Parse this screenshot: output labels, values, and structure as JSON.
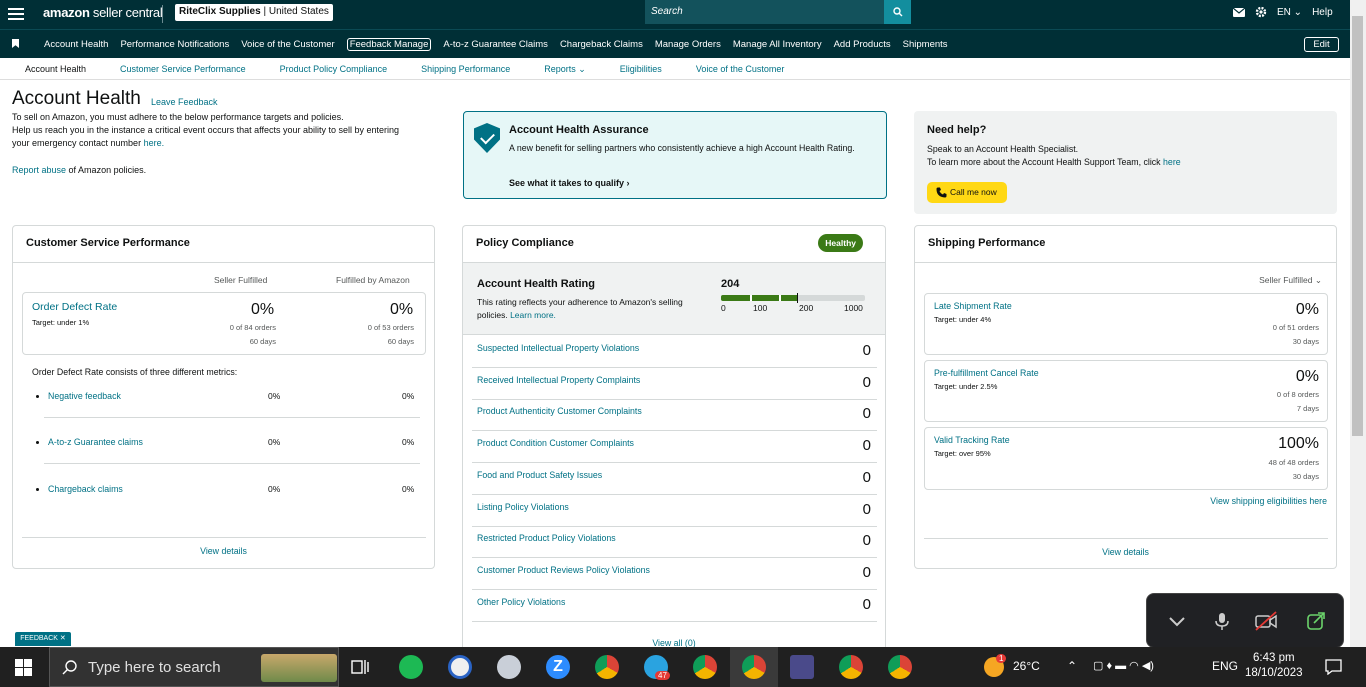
{
  "topbar": {
    "logo_main": "amazon",
    "logo_rest": " seller central",
    "store_name": "RiteClix Supplies",
    "store_region": " | United States",
    "search_placeholder": "Search",
    "lang": "EN",
    "help": "Help"
  },
  "nav": {
    "items": [
      "Account Health",
      "Performance Notifications",
      "Voice of the Customer",
      "Feedback Manage",
      "A-to-z Guarantee Claims",
      "Chargeback Claims",
      "Manage Orders",
      "Manage All Inventory",
      "Add Products",
      "Shipments"
    ],
    "edit": "Edit"
  },
  "subnav": {
    "items": [
      "Account Health",
      "Customer Service Performance",
      "Product Policy Compliance",
      "Shipping Performance",
      "Reports ⌄",
      "Eligibilities",
      "Voice of the Customer"
    ]
  },
  "header": {
    "title": "Account Health",
    "leave_feedback": "Leave Feedback",
    "line1": "To sell on Amazon, you must adhere to the below performance targets and policies.",
    "line2": "Help us reach you in the instance a critical event occurs that affects your ability to sell by entering",
    "line3_pre": "your emergency contact number ",
    "line3_link": "here.",
    "report_link": "Report abuse",
    "report_rest": " of Amazon policies."
  },
  "assurance": {
    "title": "Account Health Assurance",
    "desc": "A new benefit for selling partners who consistently achieve a high Account Health Rating.",
    "cta": "See what it takes to qualify"
  },
  "help": {
    "title": "Need help?",
    "line1": "Speak to an Account Health Specialist.",
    "line2_pre": "To learn more about the Account Health Support Team, click ",
    "line2_link": "here",
    "button": "Call me now"
  },
  "csp": {
    "title": "Customer Service Performance",
    "col_seller": "Seller Fulfilled",
    "col_fba": "Fulfilled by Amazon",
    "odr_label": "Order Defect Rate",
    "odr_target": "Target: under 1%",
    "seller_rate": "0%",
    "seller_orders": "0 of 84 orders",
    "seller_days": "60 days",
    "fba_rate": "0%",
    "fba_orders": "0 of 53 orders",
    "fba_days": "60 days",
    "intro": "Order Defect Rate consists of three different metrics:",
    "metrics": [
      {
        "label": "Negative feedback",
        "seller": "0%",
        "fba": "0%"
      },
      {
        "label": "A-to-z Guarantee claims",
        "seller": "0%",
        "fba": "0%"
      },
      {
        "label": "Chargeback claims",
        "seller": "0%",
        "fba": "0%"
      }
    ],
    "view_details": "View details"
  },
  "policy": {
    "title": "Policy Compliance",
    "badge": "Healthy",
    "ahr_title": "Account Health Rating",
    "ahr_desc_pre": "This rating reflects your adherence to Amazon's selling policies. ",
    "ahr_desc_link": "Learn more.",
    "ahr_value": "204",
    "ahr_fraction": 0.204,
    "scale": [
      "0",
      "100",
      "200",
      "1000"
    ],
    "rows": [
      {
        "label": "Suspected Intellectual Property Violations",
        "value": "0"
      },
      {
        "label": "Received Intellectual Property Complaints",
        "value": "0"
      },
      {
        "label": "Product Authenticity Customer Complaints",
        "value": "0"
      },
      {
        "label": "Product Condition Customer Complaints",
        "value": "0"
      },
      {
        "label": "Food and Product Safety Issues",
        "value": "0"
      },
      {
        "label": "Listing Policy Violations",
        "value": "0"
      },
      {
        "label": "Restricted Product Policy Violations",
        "value": "0"
      },
      {
        "label": "Customer Product Reviews Policy Violations",
        "value": "0"
      },
      {
        "label": "Other Policy Violations",
        "value": "0"
      }
    ],
    "view_all": "View all (0)"
  },
  "shipping": {
    "title": "Shipping Performance",
    "filter": "Seller Fulfilled",
    "metrics": [
      {
        "label": "Late Shipment Rate",
        "target": "Target: under 4%",
        "rate": "0%",
        "orders": "0 of 51 orders",
        "days": "30 days"
      },
      {
        "label": "Pre-fulfillment Cancel Rate",
        "target": "Target: under 2.5%",
        "rate": "0%",
        "orders": "0 of 8 orders",
        "days": "7 days"
      },
      {
        "label": "Valid Tracking Rate",
        "target": "Target: over 95%",
        "rate": "100%",
        "orders": "48 of 48 orders",
        "days": "30 days"
      }
    ],
    "eligibilities_link": "View shipping eligibilities here",
    "view_details": "View details"
  },
  "feedback_tab": "FEEDBACK ✕",
  "taskbar": {
    "search_placeholder": "Type here to search",
    "telegram_badge": "47",
    "weather_badge": "1",
    "temperature": "26°C",
    "lang": "ENG",
    "time": "6:43 pm",
    "date": "18/10/2023"
  }
}
